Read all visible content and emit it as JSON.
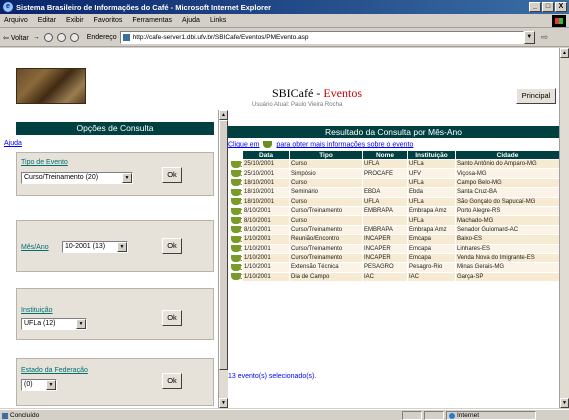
{
  "window": {
    "title": "Sistema Brasileiro de Informações do Café - Microsoft Internet Explorer",
    "controls": [
      "_",
      "□",
      "X"
    ]
  },
  "menu": [
    "Arquivo",
    "Editar",
    "Exibir",
    "Favoritos",
    "Ferramentas",
    "Ajuda",
    "Links"
  ],
  "toolbar": {
    "back_label": "Voltar",
    "address_label": "Endereço",
    "url": "http://cafe-server1.dbi.ufv.br/SBICafe/Eventos/PMEvento.asp",
    "go_icon": "go-icon"
  },
  "left": {
    "panel_title": "Opções de Consulta",
    "help_link": "Ajuda",
    "ok_label": "Ok",
    "filters": [
      {
        "label": "Tipo de Evento",
        "value": "Curso/Treinamento (20)"
      },
      {
        "label": "Mês/Ano",
        "value": "10-2001 (13)"
      },
      {
        "label": "Instituição",
        "value": "UFLa (12)"
      },
      {
        "label": "Estado da Federação",
        "value": "(0)"
      }
    ]
  },
  "right": {
    "title_main": "SBICafé - ",
    "title_accent": "Eventos",
    "subtitle": "Usuário Atual: Paulo Vieira Rocha",
    "principal_button": "Principal",
    "result_title": "Resultado da Consulta por Mês-Ano",
    "hint_before": "Clique em",
    "hint_after": "para obter mais informações sobre o evento",
    "columns": [
      "Data",
      "Tipo",
      "Nome",
      "Instituição",
      "Cidade"
    ],
    "rows": [
      [
        "25/10/2001",
        "Curso",
        "UFLA",
        "UFLa",
        "Santo Antônio do Amparo-MG"
      ],
      [
        "25/10/2001",
        "Simpósio",
        "PROCAFE",
        "UFV",
        "Viçosa-MG"
      ],
      [
        "18/10/2001",
        "Curso",
        "",
        "UFLa",
        "Campo Belo-MG"
      ],
      [
        "18/10/2001",
        "Seminário",
        "EBDA",
        "Ebda",
        "Santa Cruz-BA"
      ],
      [
        "18/10/2001",
        "Curso",
        "UFLA",
        "UFLa",
        "São Gonçalo do Sapucaí-MG"
      ],
      [
        "8/10/2001",
        "Curso/Treinamento",
        "EMBRAPA",
        "Embrapa Amz",
        "Porto Alegre-RS"
      ],
      [
        "8/10/2001",
        "Curso",
        "",
        "UFLa",
        "Machado-MG"
      ],
      [
        "8/10/2001",
        "Curso/Treinamento",
        "EMBRAPA",
        "Embrapa Amz",
        "Senador Guiomard-AC"
      ],
      [
        "1/10/2001",
        "Reunião/Encontro",
        "INCAPER",
        "Emcapa",
        "Baixo-ES"
      ],
      [
        "1/10/2001",
        "Curso/Treinamento",
        "INCAPER",
        "Emcapa",
        "Linhares-ES"
      ],
      [
        "1/10/2001",
        "Curso/Treinamento",
        "INCAPER",
        "Emcapa",
        "Venda Nova do Imigrante-ES"
      ],
      [
        "1/10/2001",
        "Extensão Técnica",
        "PESAGRO",
        "Pesagro-Rio",
        "Minas Gerais-MG"
      ],
      [
        "1/10/2001",
        "Dia de Campo",
        "IAC",
        "IAC",
        "Garça-SP"
      ]
    ],
    "count_text": "13 evento(s) selecionado(s)."
  },
  "status": {
    "text": "Concluído",
    "zone": "Internet"
  },
  "colors": {
    "header_bg": "#004040",
    "link": "#0000ff",
    "accent": "#cc0000"
  }
}
